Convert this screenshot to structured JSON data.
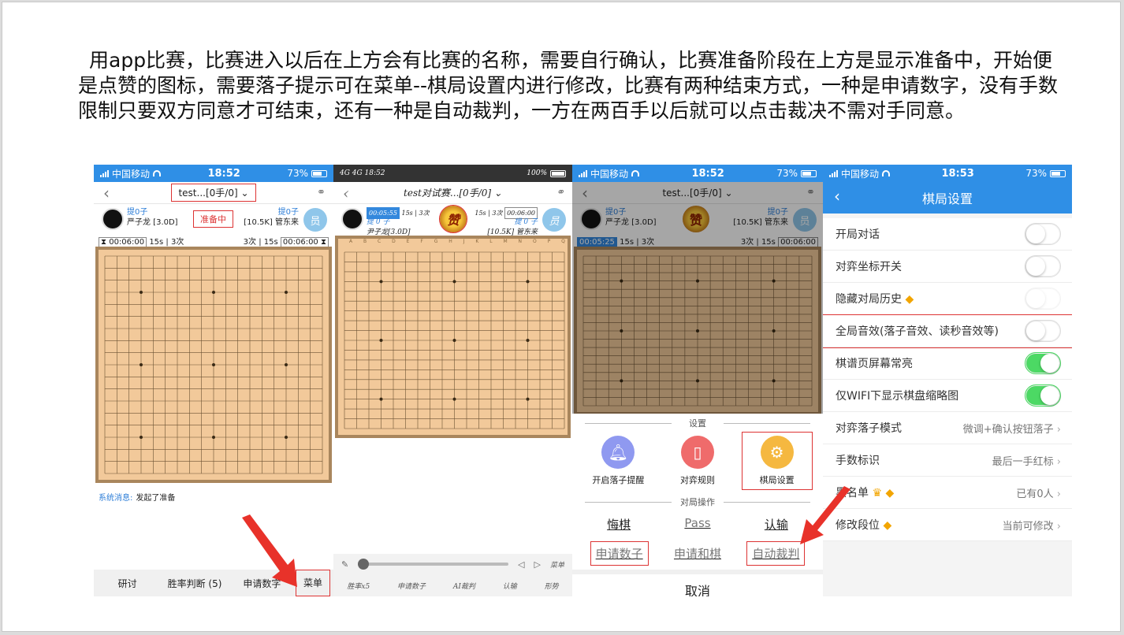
{
  "description": "用app比赛，比赛进入以后在上方会有比赛的名称，需要自行确认，比赛准备阶段在上方是显示准备中，开始便是点赞的图标，需要落子提示可在菜单--棋局设置内进行修改，比赛有两种结束方式，一种是申请数字，没有手数限制只要双方同意才可结束，还有一种是自动裁判，一方在两百手以后就可以点击裁决不需对手同意。",
  "colors": {
    "accent": "#2f8fe6",
    "highlight": "#d33333",
    "toggle_on": "#4cd964",
    "board": "#f2c99a"
  },
  "screen1": {
    "carrier": "中国移动",
    "time": "18:52",
    "battery": "73%",
    "title": "test...[0手/0]",
    "black_captured": "提0子",
    "black_player": "严子龙 [3.0D]",
    "state_badge": "准备中",
    "white_captured": "提0子",
    "white_player": "[10.5K] 管东来",
    "white_avatar": "员",
    "left_clock": "00:06:00",
    "left_byo": "15s | 3次",
    "right_byo": "3次 | 15s",
    "right_clock": "00:06:00",
    "sys_tag": "系统消息:",
    "sys_msg": "发起了准备",
    "bottom": {
      "study": "研讨",
      "winrate": "胜率判断 (5)",
      "count": "申请数字",
      "menu": "菜单"
    }
  },
  "screen2": {
    "status_left": "4G 4G 18:52",
    "status_right": "100%",
    "title": "test对试赛...[0手/0]",
    "left_clock": "00:05:55",
    "left_byo": "15s | 3次",
    "right_byo": "15s | 3次",
    "right_clock": "00:06:00",
    "black_captured": "提 0 子",
    "black_player": "尹子龙[3.0D]",
    "white_captured": "提 0 子",
    "white_player": "[10.5K] 管东来",
    "white_avatar": "员",
    "medal": "赞",
    "col_labels": "A B C D E F G H J K L M N O P Q R S T",
    "menu": "菜单",
    "bottom": [
      "胜率x5",
      "申请数子",
      "AI裁判",
      "认输",
      "形势"
    ]
  },
  "screen3": {
    "carrier": "中国移动",
    "time": "18:52",
    "battery": "73%",
    "title": "test...[0手/0]",
    "black_captured": "提0子",
    "black_player": "严子龙 [3.0D]",
    "white_captured": "提0子",
    "white_player": "[10.5K] 管东来",
    "white_avatar": "员",
    "medal": "赞",
    "left_clock": "00:05:25",
    "left_byo": "15s | 3次",
    "right_byo": "3次 | 15s",
    "right_clock": "00:06:00",
    "settings_title": "设置",
    "settings": [
      {
        "label": "开启落子提醒",
        "icon": "bell-icon"
      },
      {
        "label": "对弈规则",
        "icon": "rules-icon"
      },
      {
        "label": "棋局设置",
        "icon": "gear-icon"
      }
    ],
    "ops_title": "对局操作",
    "ops_row1": [
      "悔棋",
      "Pass",
      "认输"
    ],
    "ops_row2": [
      "申请数子",
      "申请和棋",
      "自动裁判"
    ],
    "cancel": "取消"
  },
  "screen4": {
    "carrier": "中国移动",
    "time": "18:53",
    "battery": "73%",
    "title": "棋局设置",
    "rows": [
      {
        "label": "开局对话",
        "type": "toggle",
        "on": false
      },
      {
        "label": "对弈坐标开关",
        "type": "toggle",
        "on": false
      },
      {
        "label": "隐藏对局历史",
        "type": "toggle",
        "on": false,
        "gem": true,
        "faint": true
      },
      {
        "label": "全局音效(落子音效、读秒音效等)",
        "type": "toggle",
        "on": false,
        "boxed": true
      },
      {
        "label": "棋谱页屏幕常亮",
        "type": "toggle",
        "on": true
      },
      {
        "label": "仅WIFI下显示棋盘缩略图",
        "type": "toggle",
        "on": true
      },
      {
        "label": "对弈落子模式",
        "type": "value",
        "value": "微调+确认按钮落子"
      },
      {
        "label": "手数标识",
        "type": "value",
        "value": "最后一手红标"
      },
      {
        "label": "黑名单",
        "type": "value",
        "value": "已有0人",
        "crown": true,
        "gem": true
      },
      {
        "label": "修改段位",
        "type": "value",
        "value": "当前可修改",
        "gem": true
      }
    ]
  }
}
